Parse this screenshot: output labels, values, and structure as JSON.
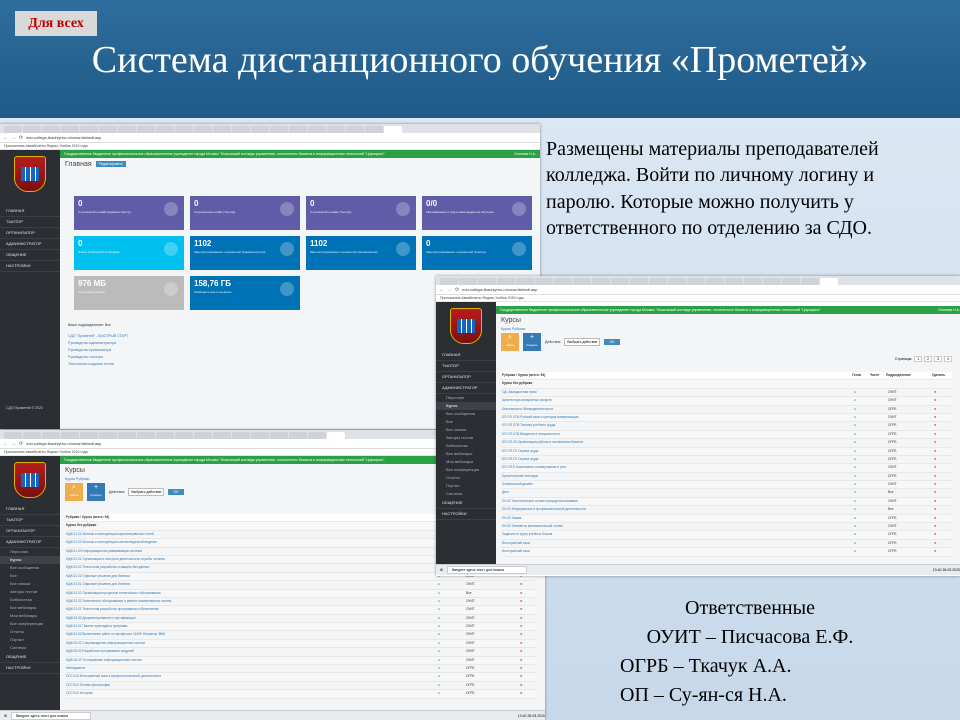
{
  "slide": {
    "badge": "Для всех",
    "title": "Система дистанционного обучения «Прометей»",
    "description": "Размещены материалы преподавателей колледжа. Войти по личному логину и паролю. Которые можно получить у ответственного по отделению за СДО.",
    "responsible": {
      "heading": "Ответственные",
      "lines": [
        "ОУИТ – Писчасова Е.Ф.",
        "ОГРБ – Ткачук А.А.",
        "ОП – Су-ян-ся Н.А."
      ]
    }
  },
  "browser": {
    "url": "edu.college-tkachiyrnu.ru/cmsr/default.asp",
    "bookmarks": "Приложения   Авиабилеты   Яндекс   Учебка 2019 года",
    "org_bar": "Государственное бюджетное профессиональное образовательное учреждение города Москвы \"Московский колледж управления, гостиничного бизнеса и информационных технологий \"Царицыно\"",
    "user": "Осипова Н.А."
  },
  "shot1": {
    "page_title": "Главная",
    "edit_label": "Редактировать",
    "menu": [
      "ГЛАВНАЯ",
      "ТЬЮТОР",
      "ОРГАНИЗАТОР",
      "АДМИНИСТРАТОР",
      "ОБЩЕНИЕ",
      "НАСТРОЙКИ"
    ],
    "cards": [
      {
        "value": "0",
        "label": "Слушателей онлайн (Администратор)"
      },
      {
        "value": "0",
        "label": "Слушателей онлайн (Тьютор)"
      },
      {
        "value": "0",
        "label": "Слушателей онлайн (Тьютор)"
      },
      {
        "value": "0/0",
        "label": "Квалификация и подготовка кадров на обучение"
      },
      {
        "value": "0",
        "label": "Новых сообщений на форуме"
      },
      {
        "value": "1102",
        "label": "Зарегистрированных слушателей (Администратор)"
      },
      {
        "value": "1102",
        "label": "Зарегистрированных слушателей (Организатор)"
      },
      {
        "value": "0",
        "label": "Зарегистрированных слушателей (Тьютор)"
      },
      {
        "value": "976 МБ",
        "label": "Системный размер"
      },
      {
        "value": "158,76 ГБ",
        "label": "Свободное место на диске"
      }
    ],
    "links_head": "Ваше подразделение: Все",
    "links": [
      "СДО \"Прометей\" - БЫСТРЫЙ СТАРТ",
      "Руководство администратора",
      "Руководство организатора",
      "Руководство тьютора",
      "Технология создания тестов"
    ],
    "footer": "СДО Прометей © 2020"
  },
  "shot2": {
    "page_title": "Курсы",
    "subtabs": "Курсы     Рубрики",
    "find_label": "Найти",
    "create_label": "Создать",
    "action_label": "Действия",
    "action_select": "Выбрать действие",
    "ok_label": "OK",
    "pages_label": "Страницы:",
    "pages": [
      "1",
      "2",
      "3",
      "4"
    ],
    "breadcrumb": "Рубрики / Курсы (всего: 94)",
    "group": "Курсы без рубрики",
    "col_headers": [
      "Готов",
      "Частн",
      "Подразделение",
      "Удалить"
    ],
    "menu": [
      "ГЛАВНАЯ",
      "ТЬЮТОР",
      "ОРГАНИЗАТОР",
      "АДМИНИСТРАТОР",
      "Персонал",
      "Курсы",
      "Все сообщения",
      "Все",
      "Все списки",
      "Авторы тестов",
      "Библиотека",
      "Все вебинары",
      "Мои вебинары",
      "Все конференции",
      "Отчеты",
      "Портал",
      "Система",
      "ОБЩЕНИЕ",
      "НАСТРОЙКИ"
    ],
    "rows": [
      {
        "name": "ОД. Авиационная пром",
        "dept": "ОУИТ"
      },
      {
        "name": "Архитектура аппаратных средств",
        "dept": "ОУИТ"
      },
      {
        "name": "Безопасность Жизнедеятельности",
        "dept": "ОГРБ"
      },
      {
        "name": "БП.ОП.СП4 Русский язык и культура коммуникации",
        "dept": "ОУИТ"
      },
      {
        "name": "БП.ОП.СП5 Техника учебного труда",
        "dept": "ОГРБ"
      },
      {
        "name": "БП.ОП.СП6 Введение в специальность",
        "dept": "ОГРБ"
      },
      {
        "name": "БП.ОП.09 Организация работы в гостиничном бизнесе",
        "dept": "ОГРБ"
      },
      {
        "name": "БП.ОП.ТО Охрана труда",
        "dept": "ОГРБ"
      },
      {
        "name": "БП.ОП.ТО Охрана труда",
        "dept": "ОГРБ"
      },
      {
        "name": "БП.ОП.Б Бизнесмены планирования и учет",
        "dept": "ОУИТ"
      },
      {
        "name": "Бухгалтерский техникум",
        "dept": "ОГРБ"
      },
      {
        "name": "Графический дизайн",
        "dept": "ОУИТ"
      },
      {
        "name": "Дизт",
        "dept": "Все"
      },
      {
        "name": "ЕН.02 Экологические основы природопользования",
        "dept": "ОУИТ"
      },
      {
        "name": "ЕН.03 Информатика в профессиональной деятельности",
        "dept": "Все"
      },
      {
        "name": "ЕН.05 Химия",
        "dept": "ОГРБ"
      },
      {
        "name": "ЕН.02 Элементы математической логики",
        "dept": "ОУИТ"
      },
      {
        "name": "Задания по курсу учебных блоков",
        "dept": "ОГРБ"
      },
      {
        "name": "Иностранный язык",
        "dept": "ОГРБ"
      },
      {
        "name": "Иностранный язык",
        "dept": "ОГРБ"
      }
    ]
  },
  "shot3": {
    "page_title": "Курсы",
    "subtabs": "Курсы     Рубрики",
    "find_label": "Найти",
    "create_label": "Создать",
    "action_label": "Действия",
    "action_select": "Выбрать действие",
    "ok_label": "OK",
    "breadcrumb": "Рубрики / Курсы (всего: 94)",
    "group": "Курсы без рубрики",
    "menu": [
      "ГЛАВНАЯ",
      "ТЬЮТОР",
      "ОРГАНИЗАТОР",
      "АДМИНИСТРАТОР",
      "Персонал",
      "Курсы",
      "Все сообщения",
      "Все",
      "Все списки",
      "Авторы тестов",
      "Библиотека",
      "Все вебинары",
      "Мои вебинары",
      "Все конференции",
      "Отчеты",
      "Портал",
      "Система",
      "ОБЩЕНИЕ",
      "НАСТРОЙКИ"
    ],
    "rows": [
      {
        "name": "МДК.01.01 Монтаж и эксплуатация мультисервисных сетей",
        "dept": "ОУИТ"
      },
      {
        "name": "МДК.01.02 Монтаж и эксплуатация систем видеонаблюдения",
        "dept": "ОУИТ"
      },
      {
        "name": "МДК.01.03 Информационно-развивающая система",
        "dept": "ОУИТ"
      },
      {
        "name": "МДК.02.01 Организация и контроль деятельности службы питания",
        "dept": "ОГРБ"
      },
      {
        "name": "МДК.02.02 Технология разработки и защиты баз данных",
        "dept": "ОУИТ"
      },
      {
        "name": "МДК.02.02 Офисные решения для бизнеса",
        "dept": "ОУИТ"
      },
      {
        "name": "МДК.03.01 Офисные решения для бизнеса",
        "dept": "ОУИТ"
      },
      {
        "name": "МДК.03.02 Организация процессов технического обслуживания",
        "dept": "Все"
      },
      {
        "name": "МДК.03.03 Техническое обслуживание и ремонт компьютерных систем",
        "dept": "ОУИТ"
      },
      {
        "name": "МДК.03.01 Технология разработки программного обеспечения",
        "dept": "ОУИТ"
      },
      {
        "name": "МДК.03.03 Документирование и сертификация",
        "dept": "ОУИТ"
      },
      {
        "name": "МДК.04.01 Пакеты прикладных программ",
        "dept": "ОУИТ"
      },
      {
        "name": "МДК.04.02 Выполнение работ по профессии 16199 Оператор ЭВМ",
        "dept": "ОУИТ"
      },
      {
        "name": "МДК.05.02 Сопровождение информационных систем",
        "dept": "ОУИТ"
      },
      {
        "name": "МДК.05.02 Разработка программных модулей",
        "dept": "ОУИТ"
      },
      {
        "name": "МДК.06.02 Тестирование информационных систем",
        "dept": "ОУИТ"
      },
      {
        "name": "Менеджмент",
        "dept": "ОГРБ"
      },
      {
        "name": "ОГСЭ.03 Иностранный язык в профессиональной деятельности",
        "dept": "ОГРБ"
      },
      {
        "name": "ОГСЭ.01 Основы философии",
        "dept": "ОГРБ"
      },
      {
        "name": "ОГСЭ.02 История",
        "dept": "ОГРБ"
      }
    ],
    "search_placeholder": "Введите здесь текст для поиска"
  },
  "taskbar": {
    "search": "Введите здесь текст для поиска",
    "time": "13:40",
    "date": "26.03.2020"
  },
  "colors": {
    "header": "#1f5a88",
    "green_bar": "#2aa144",
    "card_purple": "#605ca8",
    "card_blue": "#0073b7",
    "card_aqua": "#00c0ef",
    "card_orange": "#f39c12",
    "card_grey": "#bbbbbb",
    "sidebar": "#2b2f33"
  }
}
